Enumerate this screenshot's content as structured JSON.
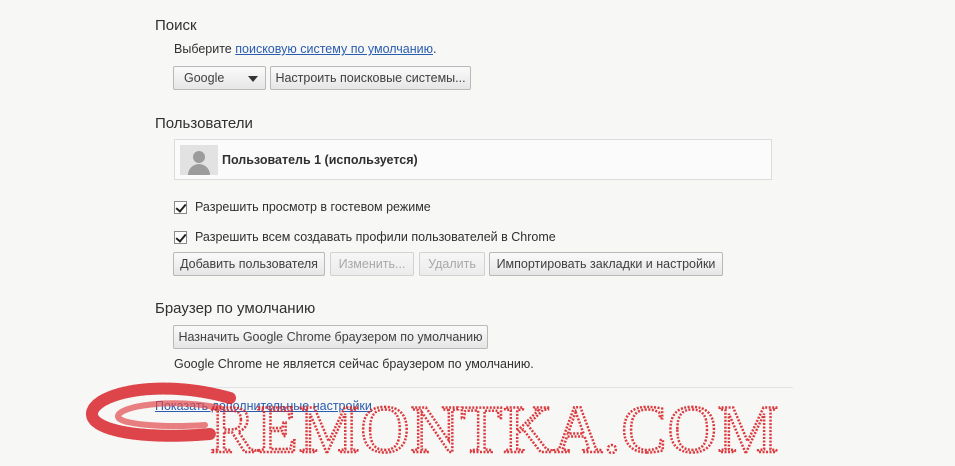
{
  "search": {
    "title": "Поиск",
    "prompt_prefix": "Выберите ",
    "prompt_link": "поисковую систему по умолчанию",
    "prompt_suffix": ".",
    "engine_selected": "Google",
    "manage_button": "Настроить поисковые системы..."
  },
  "users": {
    "title": "Пользователи",
    "current_user": "Пользователь 1 (используется)",
    "guest_checkbox": {
      "label": "Разрешить просмотр в гостевом режиме",
      "checked": true
    },
    "profiles_checkbox": {
      "label": "Разрешить всем создавать профили пользователей в Chrome",
      "checked": true
    },
    "buttons": {
      "add": "Добавить пользователя",
      "edit": "Изменить...",
      "delete": "Удалить",
      "import": "Импортировать закладки и настройки"
    }
  },
  "default_browser": {
    "title": "Браузер по умолчанию",
    "set_button": "Назначить Google Chrome браузером по умолчанию",
    "status": "Google Chrome не является сейчас браузером по умолчанию."
  },
  "advanced_link": "Показать дополнительные настройки",
  "watermark_text": "REMONTKA.COM",
  "colors": {
    "link": "#2a5db0",
    "watermark": "#d9262c"
  }
}
